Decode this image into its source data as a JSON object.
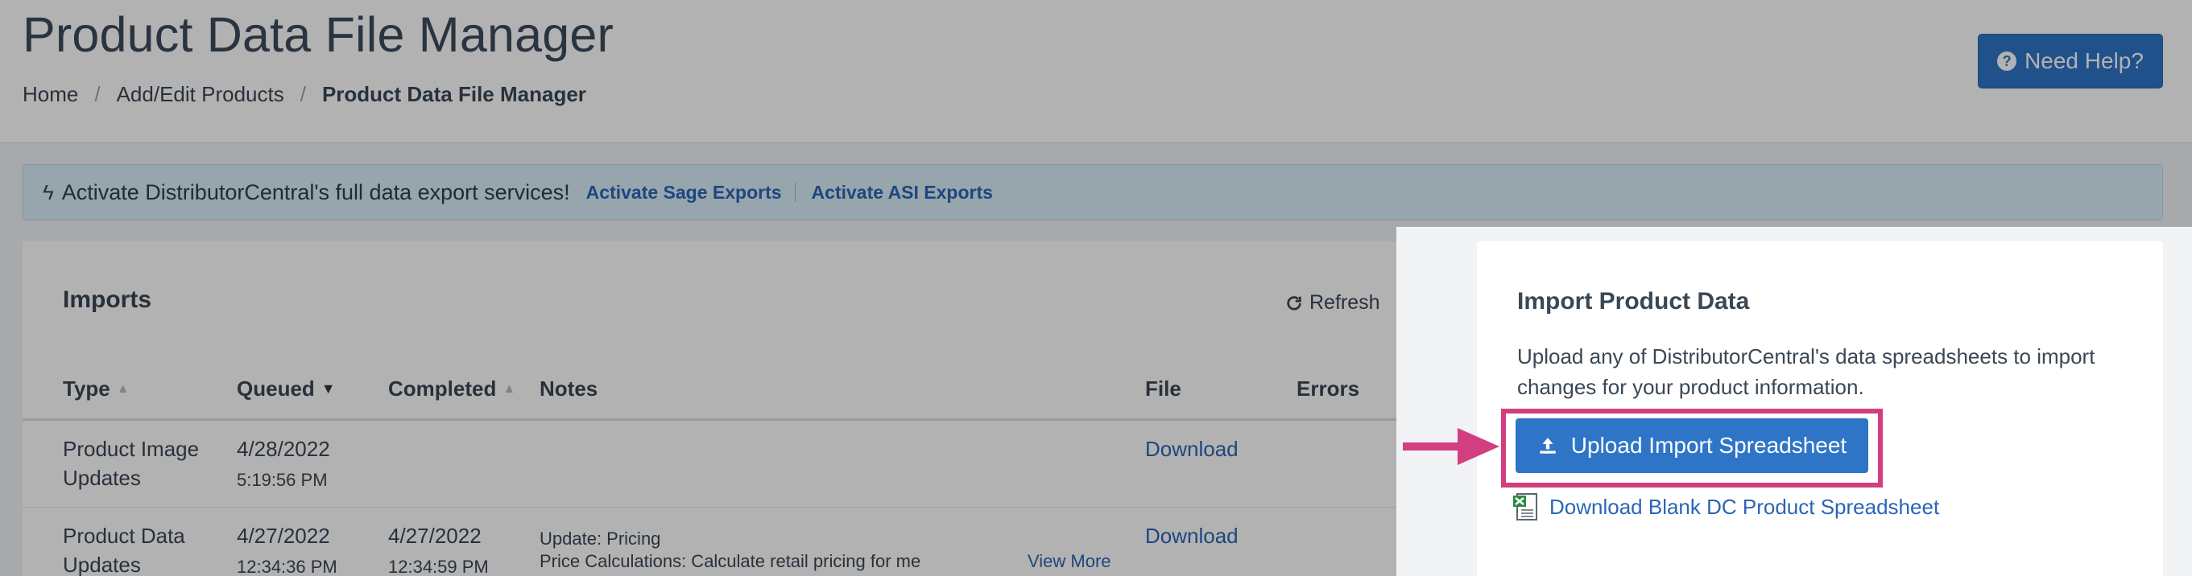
{
  "header": {
    "title": "Product Data File Manager",
    "help_label": "Need Help?",
    "breadcrumb": [
      "Home",
      "Add/Edit Products",
      "Product Data File Manager"
    ],
    "breadcrumb_sep": "/"
  },
  "alert": {
    "message": "Activate DistributorCentral's full data export services!",
    "links": [
      "Activate Sage Exports",
      "Activate ASI Exports"
    ]
  },
  "imports": {
    "title": "Imports",
    "refresh_label": "Refresh",
    "columns": [
      "Type",
      "Queued",
      "Completed",
      "Notes",
      "File",
      "Errors"
    ],
    "rows": [
      {
        "type": [
          "Product Image",
          "Updates"
        ],
        "queued_date": "4/28/2022",
        "queued_time": "5:19:56 PM",
        "completed_date": "",
        "completed_time": "",
        "notes": [
          "",
          ""
        ],
        "view_more": "",
        "file": "Download"
      },
      {
        "type": [
          "Product Data",
          "Updates"
        ],
        "queued_date": "4/27/2022",
        "queued_time": "12:34:36 PM",
        "completed_date": "4/27/2022",
        "completed_time": "12:34:59 PM",
        "notes": [
          "Update: Pricing",
          "Price Calculations: Calculate retail pricing for me"
        ],
        "view_more": "View More",
        "file": "Download"
      }
    ]
  },
  "import_panel": {
    "title": "Import Product Data",
    "description": "Upload any of DistributorCentral's data spreadsheets to import changes for your product information.",
    "upload_label": "Upload Import Spreadsheet",
    "download_blank_label": "Download Blank DC Product Spreadsheet"
  },
  "colors": {
    "primary": "#2f75c7",
    "link": "#2a66b5",
    "highlight": "#d23e7f",
    "alert_bg": "#d8ecf8"
  }
}
